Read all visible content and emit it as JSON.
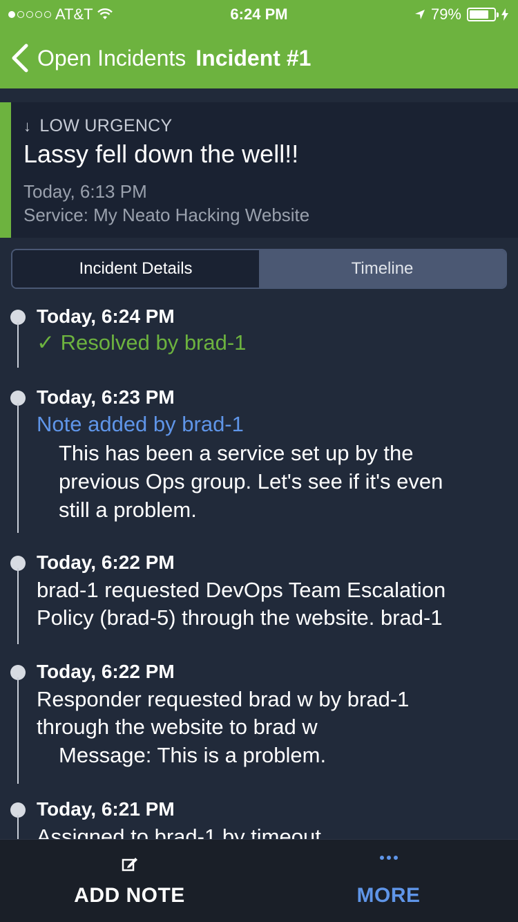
{
  "status_bar": {
    "carrier": "AT&T",
    "time": "6:24 PM",
    "battery": "79%",
    "signal_bars": 1,
    "signal_total": 5
  },
  "nav": {
    "back_label": "Open Incidents",
    "title": "Incident #1"
  },
  "incident": {
    "urgency": "LOW URGENCY",
    "title": "Lassy fell down the well!!",
    "time": "Today, 6:13 PM",
    "service": "Service: My Neato Hacking Website",
    "accent_color": "#6db33f"
  },
  "tabs": [
    {
      "label": "Incident Details",
      "active": true
    },
    {
      "label": "Timeline",
      "active": false
    }
  ],
  "timeline": [
    {
      "time": "Today, 6:24 PM",
      "headline": "Resolved by brad-1",
      "status": "resolved"
    },
    {
      "time": "Today, 6:23 PM",
      "headline": "Note added by brad-1",
      "note_lines": [
        "This has been a service set up by the",
        "previous Ops group. Let's see if it's even",
        "still a problem."
      ]
    },
    {
      "time": "Today, 6:22 PM",
      "lines": [
        "brad-1 requested DevOps Team Escalation",
        "Policy (brad-5) through the website. brad-1"
      ]
    },
    {
      "time": "Today, 6:22 PM",
      "lines": [
        "Responder requested brad w by brad-1",
        "through the website to brad w"
      ],
      "message": "Message: This is a problem."
    },
    {
      "time": "Today, 6:21 PM",
      "lines": [
        "Assigned to brad-1 by timeout"
      ]
    }
  ],
  "bottom_bar": {
    "add_note_label": "ADD NOTE",
    "more_label": "MORE",
    "more_color": "#5f95e8"
  }
}
